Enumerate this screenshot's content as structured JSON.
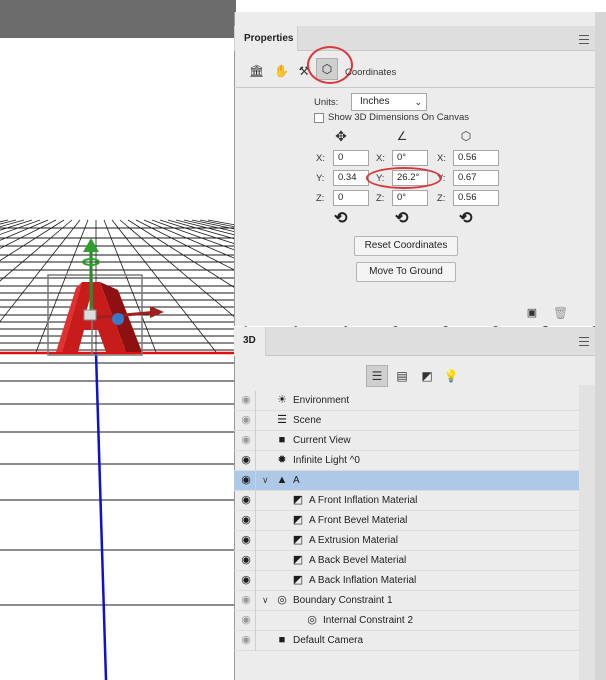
{
  "strip": {
    "collapse_glyph": "«",
    "close_glyph": "×"
  },
  "properties": {
    "tab_label": "Properties",
    "toolbar_icons": [
      "mesh-icon",
      "deform-icon",
      "cap-icon",
      "coordinates-icon"
    ],
    "coordinates_label": "Coordinates",
    "units_label": "Units:",
    "units_value": "Inches",
    "show_dims_label": "Show 3D Dimensions On Canvas",
    "show_dims_checked": false,
    "columns": [
      {
        "icon": "move-icon",
        "fields": [
          {
            "axis": "X:",
            "value": "0"
          },
          {
            "axis": "Y:",
            "value": "0.34"
          },
          {
            "axis": "Z:",
            "value": "0"
          }
        ]
      },
      {
        "icon": "rotate-angle-icon",
        "fields": [
          {
            "axis": "X:",
            "value": "0°"
          },
          {
            "axis": "Y:",
            "value": "26.2°"
          },
          {
            "axis": "Z:",
            "value": "0°"
          }
        ]
      },
      {
        "icon": "scale-icon",
        "fields": [
          {
            "axis": "X:",
            "value": "0.56"
          },
          {
            "axis": "Y:",
            "value": "0.67"
          },
          {
            "axis": "Z:",
            "value": "0.56"
          }
        ]
      }
    ],
    "reset_coordinates_label": "Reset Coordinates",
    "move_to_ground_label": "Move To Ground",
    "footer_icons": [
      "render-icon",
      "trash-icon"
    ]
  },
  "panel3d": {
    "tab_label": "3D",
    "filter_icons": [
      "scene-filter-icon",
      "meshes-filter-icon",
      "materials-filter-icon",
      "lights-filter-icon"
    ],
    "rows": [
      {
        "label": "Environment",
        "icon": "environment-icon",
        "visible": false,
        "indent": 0,
        "twirl": ""
      },
      {
        "label": "Scene",
        "icon": "scene-icon",
        "visible": false,
        "indent": 0,
        "twirl": ""
      },
      {
        "label": "Current View",
        "icon": "camera-icon",
        "visible": false,
        "indent": 1,
        "twirl": ""
      },
      {
        "label": "Infinite Light ^0",
        "icon": "light-icon",
        "visible": true,
        "indent": 1,
        "twirl": ""
      },
      {
        "label": "A",
        "icon": "mesh-icon",
        "visible": true,
        "indent": 0,
        "twirl": "v",
        "selected": true
      },
      {
        "label": "A Front Inflation Material",
        "icon": "material-icon",
        "visible": true,
        "indent": 2,
        "twirl": ""
      },
      {
        "label": "A Front Bevel Material",
        "icon": "material-icon",
        "visible": true,
        "indent": 2,
        "twirl": ""
      },
      {
        "label": "A Extrusion Material",
        "icon": "material-icon",
        "visible": true,
        "indent": 2,
        "twirl": ""
      },
      {
        "label": "A Back Bevel Material",
        "icon": "material-icon",
        "visible": true,
        "indent": 2,
        "twirl": ""
      },
      {
        "label": "A Back Inflation Material",
        "icon": "material-icon",
        "visible": true,
        "indent": 2,
        "twirl": ""
      },
      {
        "label": "Boundary Constraint 1",
        "icon": "constraint-icon",
        "visible": false,
        "indent": 1,
        "twirl": "v"
      },
      {
        "label": "Internal Constraint 2",
        "icon": "constraint-icon",
        "visible": false,
        "indent": 3,
        "twirl": ""
      },
      {
        "label": "Default Camera",
        "icon": "camera-icon",
        "visible": false,
        "indent": 1,
        "twirl": ""
      }
    ]
  },
  "colors": {
    "panel_bg": "#ececec",
    "selection": "#aec8e8",
    "annotation_red": "#d9383c",
    "ground_line": "#e01010",
    "z_axis": "#1010d0"
  }
}
